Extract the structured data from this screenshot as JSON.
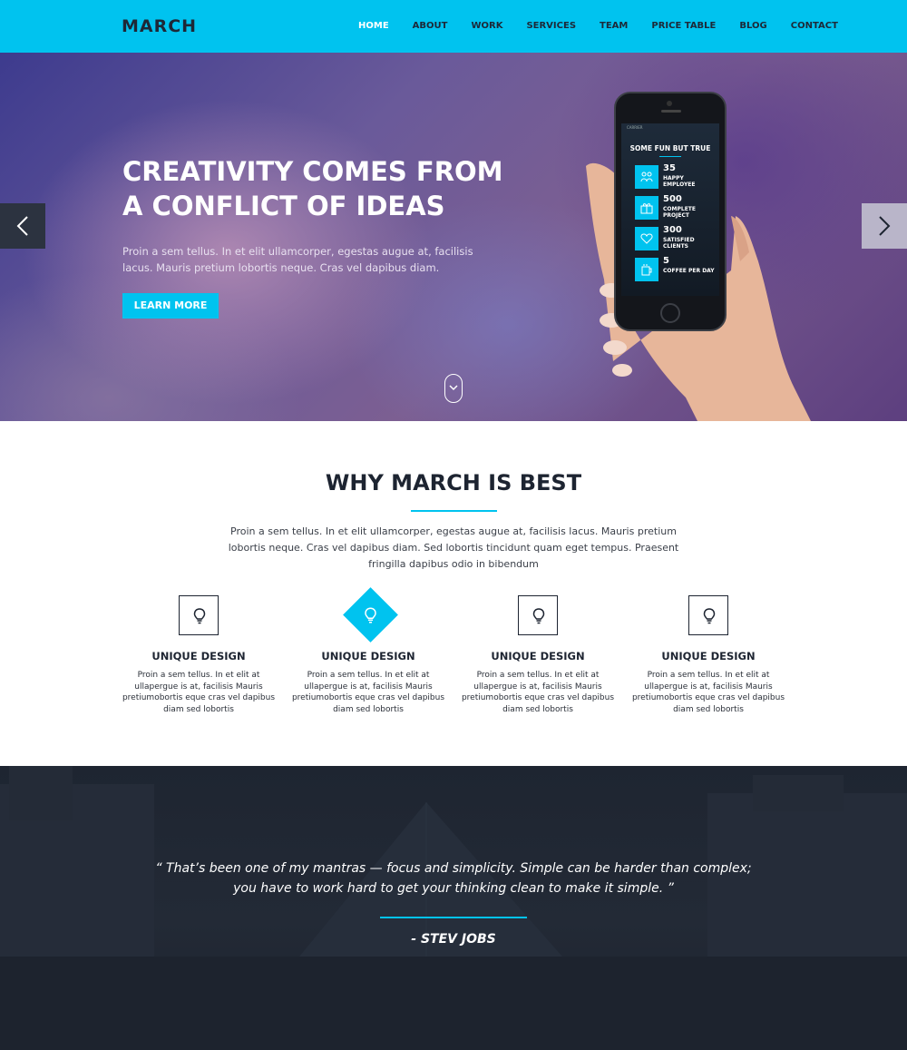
{
  "nav": {
    "logo": "MARCH",
    "items": [
      "HOME",
      "ABOUT",
      "WORK",
      "SERVICES",
      "TEAM",
      "PRICE TABLE",
      "BLOG",
      "CONTACT"
    ],
    "active_index": 0
  },
  "hero": {
    "title": "CREATIVITY COMES FROM A CONFLICT OF IDEAS",
    "text": "Proin a sem tellus. In et elit ullamcorper, egestas augue at, facilisis lacus. Mauris pretium lobortis neque. Cras vel dapibus diam.",
    "button": "LEARN MORE",
    "prev_icon": "chevron-left-icon",
    "next_icon": "chevron-right-icon",
    "scroll_icon": "chevron-down-icon"
  },
  "phone": {
    "carrier": "CARRIER",
    "title": "SOME FUN BUT TRUE",
    "stats": [
      {
        "num": "35",
        "label": "HAPPY EMPLOYEE",
        "icon": "people-icon"
      },
      {
        "num": "500",
        "label": "COMPLETE PROJECT",
        "icon": "gift-icon"
      },
      {
        "num": "300",
        "label": "SATISFIED CLIENTS",
        "icon": "heart-icon"
      },
      {
        "num": "5",
        "label": "COFFEE PER DAY",
        "icon": "coffee-icon"
      }
    ]
  },
  "why": {
    "title": "WHY MARCH IS BEST",
    "text": "Proin a sem tellus. In et elit ullamcorper, egestas augue at, facilisis lacus. Mauris pretium lobortis neque. Cras vel dapibus diam. Sed lobortis tincidunt quam eget tempus. Praesent fringilla dapibus odio in bibendum",
    "features": [
      {
        "title": "UNIQUE DESIGN",
        "text": "Proin a sem tellus. In et elit at ullapergue is at, facilisis Mauris pretiumobortis eque cras vel dapibus diam sed lobortis",
        "icon": "lightbulb-icon"
      },
      {
        "title": "UNIQUE DESIGN",
        "text": "Proin a sem tellus. In et elit at ullapergue is at, facilisis Mauris pretiumobortis eque cras vel dapibus diam sed lobortis",
        "icon": "lightbulb-icon"
      },
      {
        "title": "UNIQUE DESIGN",
        "text": "Proin a sem tellus. In et elit at ullapergue is at, facilisis Mauris pretiumobortis eque cras vel dapibus diam sed lobortis",
        "icon": "lightbulb-icon"
      },
      {
        "title": "UNIQUE DESIGN",
        "text": "Proin a sem tellus. In et elit at ullapergue is at, facilisis Mauris pretiumobortis eque cras vel dapibus diam sed lobortis",
        "icon": "lightbulb-icon"
      }
    ]
  },
  "quote": {
    "line1": "“ That’s been one of my mantras — focus and simplicity. Simple can be harder than complex;",
    "line2": "you have to work hard to get your thinking clean to make it simple. ”",
    "author": "- STEV JOBS"
  },
  "colors": {
    "accent": "#00c3ef",
    "dark": "#1d2431"
  }
}
